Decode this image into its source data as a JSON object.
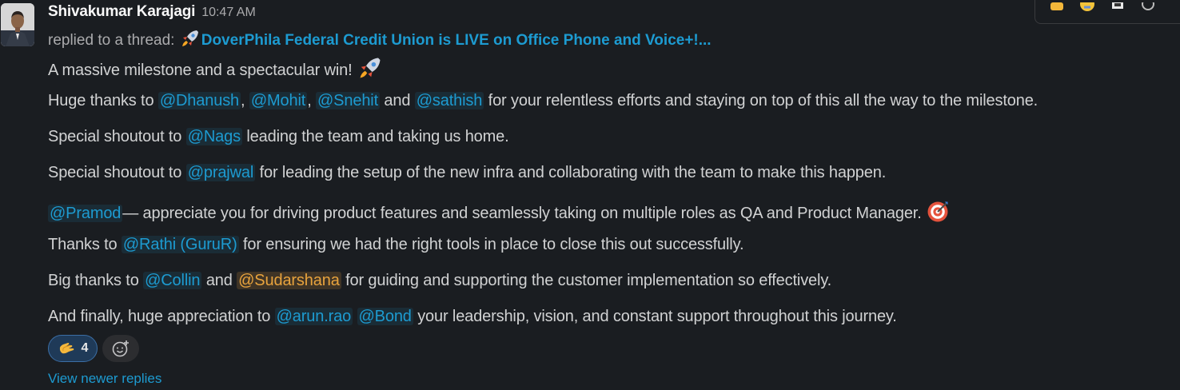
{
  "message": {
    "author": "Shivakumar Karajagi",
    "time": "10:47 AM",
    "replied_prefix": "replied to a thread:",
    "thread_title": "DoverPhila Federal Credit Union is LIVE on Office Phone and Voice+!...",
    "lines": {
      "l1": {
        "t1": "A massive milestone and a spectacular win!"
      },
      "l2": {
        "t1": "Huge thanks to",
        "m1": "@Dhanush",
        "t2": ",",
        "m2": "@Mohit",
        "t3": ",",
        "m3": "@Snehit",
        "t4": "and",
        "m4": "@sathish",
        "t5": "for your relentless efforts and staying on top of this all the way to the milestone."
      },
      "l3": {
        "t1": "Special shoutout to",
        "m1": "@Nags",
        "t2": "leading the team and taking us home."
      },
      "l4": {
        "t1": "Special shoutout to",
        "m1": "@prajwal",
        "t2": "for leading the setup of the new infra and collaborating with the team to make this happen."
      },
      "l5": {
        "m1": "@Pramod",
        "t1": "— appreciate you for driving product features and seamlessly taking on multiple roles as QA and Product Manager."
      },
      "l6": {
        "t1": "Thanks to",
        "m1": "@Rathi (GuruR)",
        "t2": "for ensuring we had the right tools in place to close this out successfully."
      },
      "l7": {
        "t1": "Big thanks to",
        "m1": "@Collin",
        "t2": "and",
        "m2": "@Sudarshana",
        "t3": "for guiding and supporting the customer implementation so effectively."
      },
      "l8": {
        "t1": "And finally, huge appreciation to",
        "m1": "@arun.rao",
        "m2": "@Bond",
        "t2": "your leadership, vision, and constant support throughout this journey."
      }
    },
    "reaction": {
      "emoji": "clapping-hands-icon",
      "count": "4"
    },
    "view_newer": "View newer replies"
  },
  "colors": {
    "background": "#1a1d21",
    "mention": "#1d9bd1",
    "self_mention": "#e8a33d",
    "text": "#d1d2d3"
  }
}
